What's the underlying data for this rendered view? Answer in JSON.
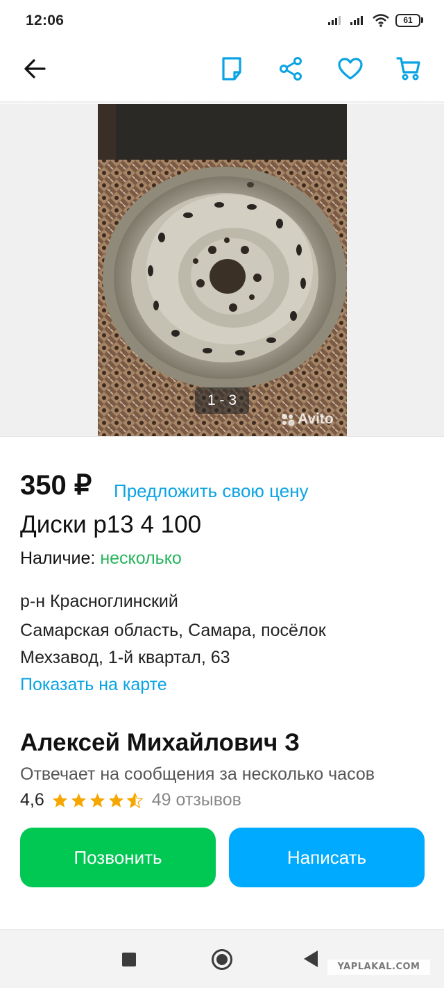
{
  "status_bar": {
    "time": "12:06",
    "battery": "61",
    "icons": [
      "signal-icon",
      "signal-icon",
      "wifi-icon",
      "battery-icon"
    ]
  },
  "toolbar": {
    "icons": [
      "back-arrow-icon",
      "note-icon",
      "share-icon",
      "heart-icon",
      "cart-icon"
    ]
  },
  "gallery": {
    "counter": "1 - 3",
    "watermark": "Avito"
  },
  "listing": {
    "price": "350 ₽",
    "offer_price": "Предложить свою цену",
    "title": "Диски р13 4 100",
    "availability_label": "Наличие:",
    "availability_value": "несколько",
    "address": [
      "р-н Красноглинский",
      "Самарская область, Самара, посёлок",
      "Мехзавод, 1-й квартал, 63"
    ],
    "map_link": "Показать на карте"
  },
  "seller": {
    "name": "Алексей Михайлович З",
    "reply_time": "Отвечает на сообщения за несколько часов",
    "rating": "4,6",
    "rating_stars": 4.6,
    "reviews": "49 отзывов"
  },
  "actions": {
    "call": "Позвонить",
    "write": "Написать"
  },
  "colors": {
    "accent_blue": "#0aa3e3",
    "call_green": "#00c853",
    "write_blue": "#00aaff",
    "availability_green": "#25b45b",
    "star": "#f6a600"
  },
  "site_watermark": "YAPLAKAL.COM"
}
